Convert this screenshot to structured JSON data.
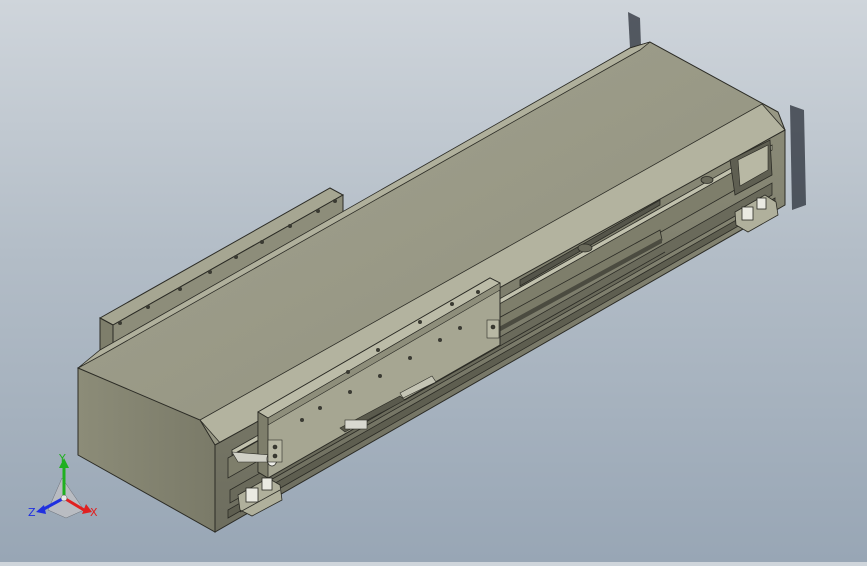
{
  "viewport": {
    "background_top": "#cfd5db",
    "background_bottom": "#98a6b5"
  },
  "model": {
    "body_color": "#9a9a86",
    "body_dark": "#6f6f60",
    "body_light": "#a8a894",
    "edge_color": "#2b2b25"
  },
  "triad": {
    "x_label": "X",
    "y_label": "Y",
    "z_label": "Z",
    "x_color": "#e02020",
    "y_color": "#20b020",
    "z_color": "#2030e0"
  }
}
